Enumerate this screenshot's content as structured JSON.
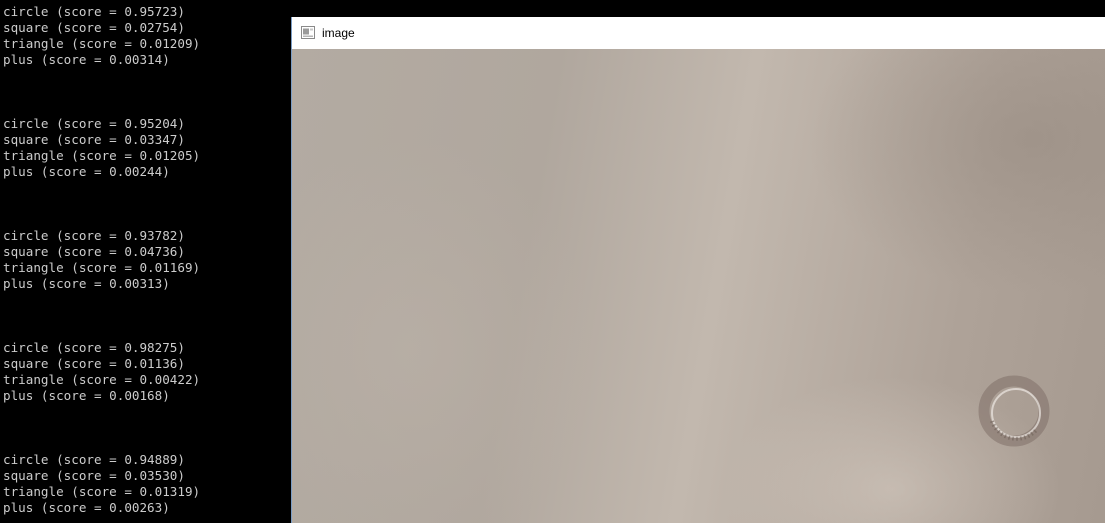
{
  "console": {
    "groups": [
      {
        "lines": [
          "circle (score = 0.95723)",
          "square (score = 0.02754)",
          "triangle (score = 0.01209)",
          "plus (score = 0.00314)"
        ]
      },
      {
        "lines": [
          "circle (score = 0.95204)",
          "square (score = 0.03347)",
          "triangle (score = 0.01205)",
          "plus (score = 0.00244)"
        ]
      },
      {
        "lines": [
          "circle (score = 0.93782)",
          "square (score = 0.04736)",
          "triangle (score = 0.01169)",
          "plus (score = 0.00313)"
        ]
      },
      {
        "lines": [
          "circle (score = 0.98275)",
          "square (score = 0.01136)",
          "triangle (score = 0.00422)",
          "plus (score = 0.00168)"
        ]
      },
      {
        "lines": [
          "circle (score = 0.94889)",
          "square (score = 0.03530)",
          "triangle (score = 0.01319)",
          "plus (score = 0.00263)"
        ]
      }
    ]
  },
  "image_window": {
    "title": "image",
    "icon": "app-window-icon",
    "content_icon": "drawn-circle-icon"
  },
  "colors": {
    "console_background": "#000000",
    "console_text": "#cccccc",
    "window_border": "#7a9cc4",
    "drawn_circle": "#7f7068"
  }
}
